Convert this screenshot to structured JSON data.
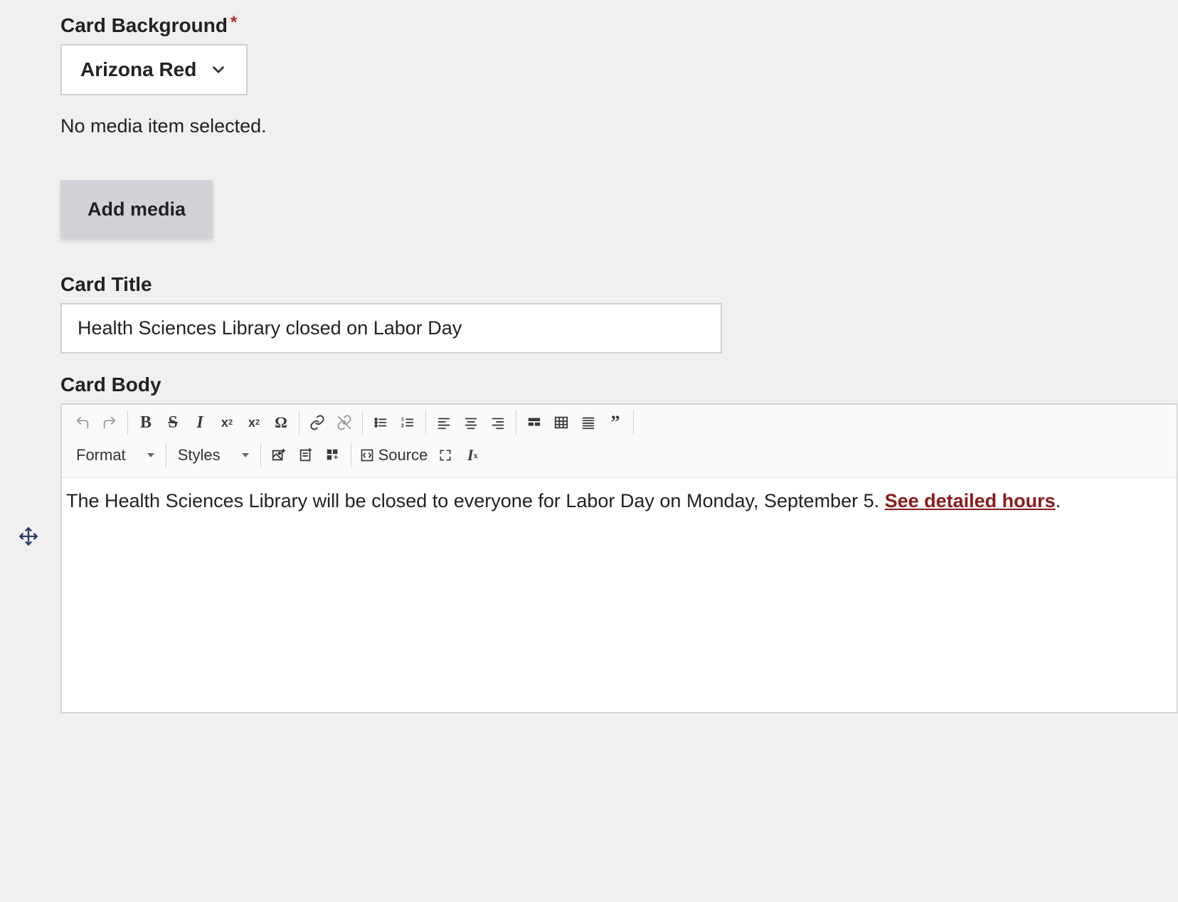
{
  "card_background": {
    "label": "Card Background",
    "required": true,
    "selected": "Arizona Red"
  },
  "media": {
    "empty_text": "No media item selected.",
    "add_button": "Add media"
  },
  "card_title": {
    "label": "Card Title",
    "value": "Health Sciences Library closed on Labor Day"
  },
  "card_body": {
    "label": "Card Body",
    "text_before_link": "The Health Sciences Library will be closed to everyone for Labor Day on Monday, September 5. ",
    "link_text": "See detailed hours",
    "text_after_link": "."
  },
  "toolbar": {
    "format_label": "Format",
    "styles_label": "Styles",
    "source_label": "Source"
  },
  "colors": {
    "link": "#8b1a1a",
    "required": "#b72a2a"
  }
}
